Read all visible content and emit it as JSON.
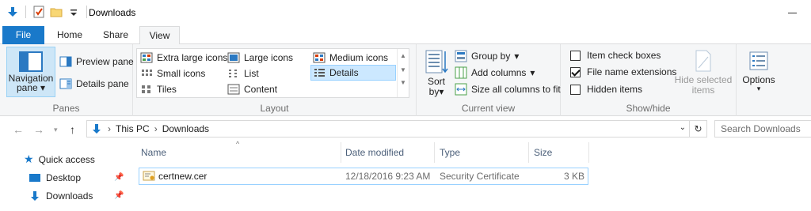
{
  "window": {
    "title": "Downloads",
    "accent": "#1979ca"
  },
  "tabs": {
    "file": "File",
    "home": "Home",
    "share": "Share",
    "view": "View"
  },
  "ribbon": {
    "panes": {
      "label": "Panes",
      "navigation_pane_line1": "Navigation",
      "navigation_pane_line2": "pane",
      "preview_pane": "Preview pane",
      "details_pane": "Details pane"
    },
    "layout": {
      "label": "Layout",
      "items": {
        "extra_large": "Extra large icons",
        "large": "Large icons",
        "medium": "Medium icons",
        "small": "Small icons",
        "list": "List",
        "details": "Details",
        "tiles": "Tiles",
        "content": "Content"
      },
      "selected": "Details"
    },
    "current_view": {
      "label": "Current view",
      "sort_by_line1": "Sort",
      "sort_by_line2": "by",
      "group_by": "Group by",
      "add_columns": "Add columns",
      "size_all_columns": "Size all columns to fit"
    },
    "show_hide": {
      "label": "Show/hide",
      "item_check_boxes": "Item check boxes",
      "item_check_boxes_checked": false,
      "file_name_extensions": "File name extensions",
      "file_name_extensions_checked": true,
      "hidden_items": "Hidden items",
      "hidden_items_checked": false,
      "hide_selected_line1": "Hide selected",
      "hide_selected_line2": "items"
    },
    "options": "Options"
  },
  "address": {
    "path": [
      "This PC",
      "Downloads"
    ],
    "search_placeholder": "Search Downloads"
  },
  "sidebar": {
    "items": [
      {
        "label": "Quick access"
      },
      {
        "label": "Desktop"
      },
      {
        "label": "Downloads"
      }
    ]
  },
  "filelist": {
    "columns": [
      "Name",
      "Date modified",
      "Type",
      "Size"
    ],
    "rows": [
      {
        "name": "certnew.cer",
        "date": "12/18/2016 9:23 AM",
        "type": "Security Certificate",
        "size": "3 KB"
      }
    ]
  }
}
